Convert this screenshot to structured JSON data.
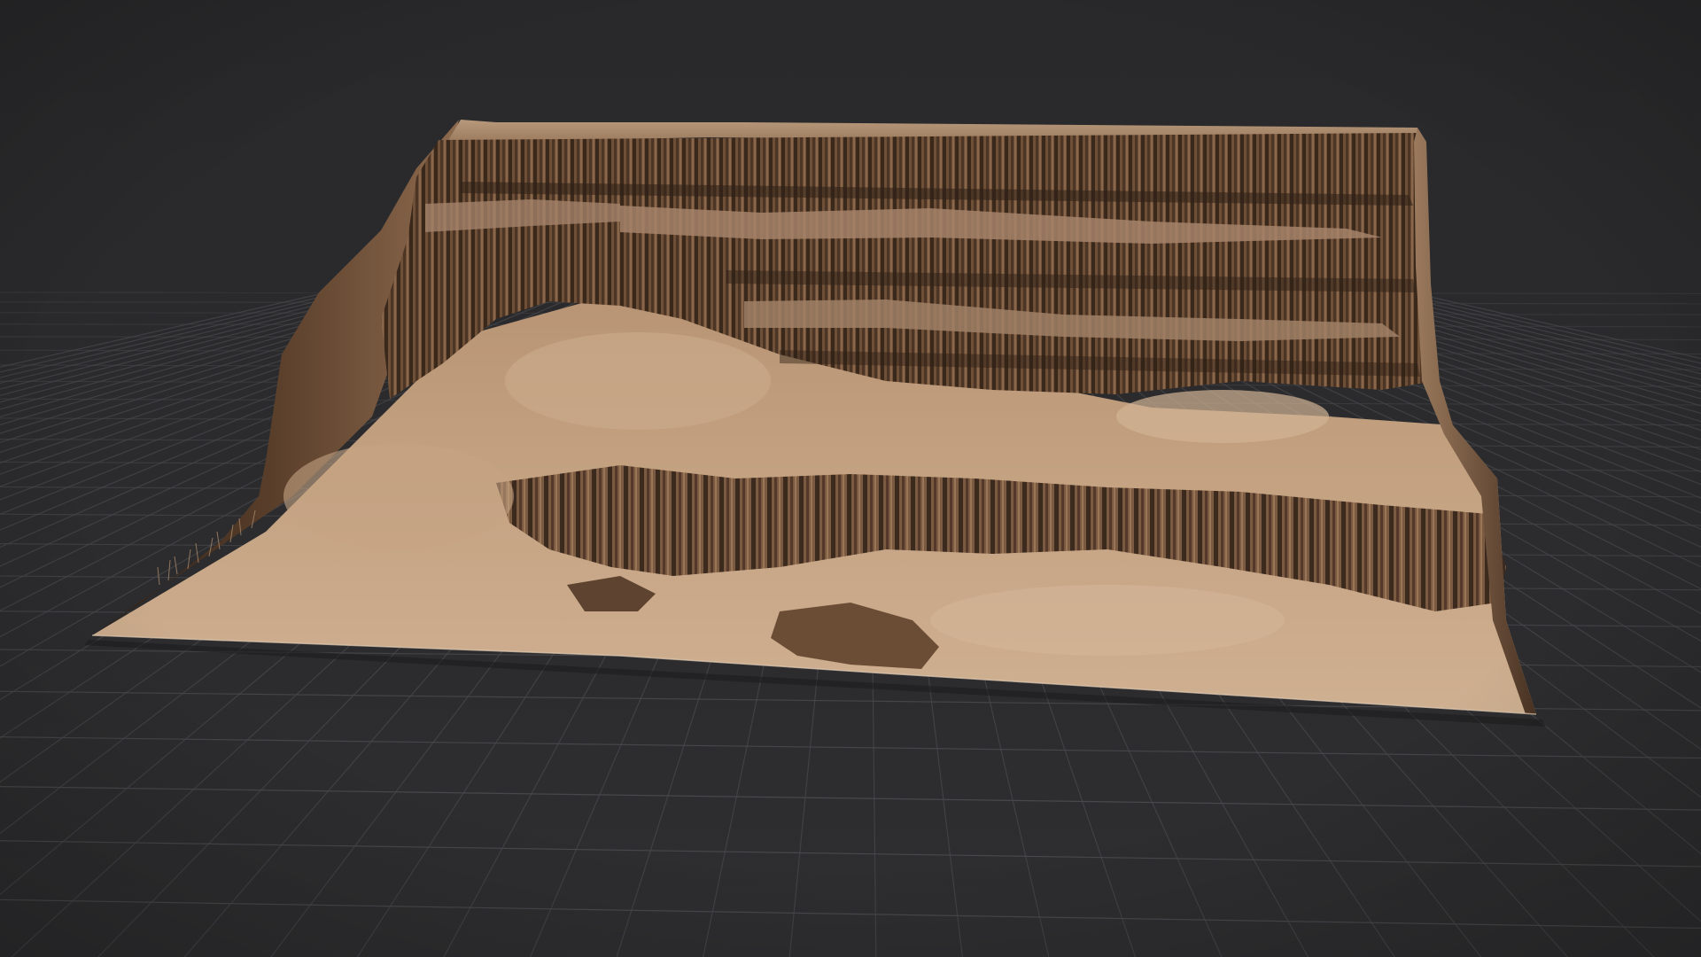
{
  "viewport": {
    "content": "3d-terrain-render",
    "ground_plane": "grid",
    "background_color": "#2b2b2d",
    "grid_line_color": "#48484c",
    "terrain_colors": {
      "sand_light": "#c9a887",
      "sand_mid": "#a98667",
      "rock_dark": "#3c2a1e",
      "rock_mid": "#6e5038",
      "plateau_top": "#b89a7e"
    }
  }
}
